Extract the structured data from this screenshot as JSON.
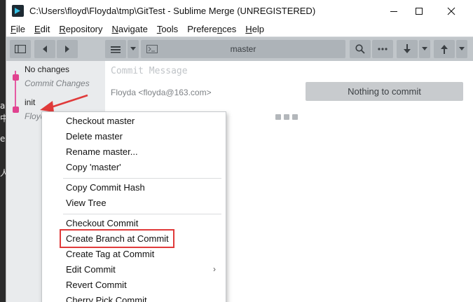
{
  "window": {
    "title": "C:\\Users\\floyd\\Floyda\\tmp\\GitTest - Sublime Merge (UNREGISTERED)"
  },
  "menubar": [
    {
      "label": "File",
      "key": "F",
      "rest": "ile"
    },
    {
      "label": "Edit",
      "key": "E",
      "rest": "dit"
    },
    {
      "label": "Repository",
      "key": "R",
      "rest": "epository"
    },
    {
      "label": "Navigate",
      "key": "N",
      "rest": "avigate"
    },
    {
      "label": "Tools",
      "key": "T",
      "rest": "ools"
    },
    {
      "label": "Preferences",
      "key": "n",
      "pre": "Prefere",
      "rest": "ces"
    },
    {
      "label": "Help",
      "key": "H",
      "rest": "elp"
    }
  ],
  "toolbar": {
    "branch": "master",
    "icons": [
      "sidebar-toggle-icon",
      "back-arrow-icon",
      "forward-arrow-icon",
      "stash-icon",
      "dropdown-icon",
      "terminal-icon",
      "search-icon",
      "more-icon",
      "pull-icon",
      "push-icon"
    ]
  },
  "commits": [
    {
      "title": "No changes",
      "subtitle": "Commit Changes"
    },
    {
      "title": "init",
      "subtitle": "Floyda"
    }
  ],
  "main": {
    "commit_placeholder": "Commit Message",
    "author": "Floyda <floyda@163.com>",
    "nothing_button": "Nothing to commit"
  },
  "context_menu": {
    "group1": [
      "Checkout master",
      "Delete master",
      "Rename master...",
      "Copy 'master'"
    ],
    "group2": [
      "Copy Commit Hash",
      "View Tree"
    ],
    "group3": [
      "Checkout Commit",
      "Create Branch at Commit",
      "Create Tag at Commit",
      "Edit Commit",
      "Revert Commit",
      "Cherry Pick Commit"
    ],
    "highlighted": "Create Branch at Commit"
  },
  "colors": {
    "accent_pink": "#e0428f",
    "annotation_red": "#e03a3a",
    "toolbar": "#c1c6ca"
  },
  "background_glyphs": [
    "a",
    "中",
    "e",
    "人"
  ]
}
